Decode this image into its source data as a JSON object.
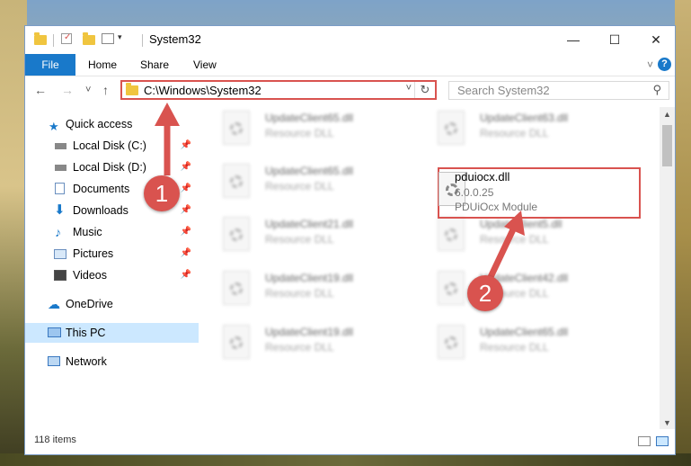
{
  "window": {
    "title": "System32",
    "minimize": "—",
    "maximize": "☐",
    "close": "✕"
  },
  "ribbon": {
    "tabs": [
      "File",
      "Home",
      "Share",
      "View"
    ],
    "expand": "˅",
    "help": "?"
  },
  "nav": {
    "back": "←",
    "forward": "→",
    "recent": "˅",
    "up": "↑",
    "address": "C:\\Windows\\System32",
    "address_dropdown": "˅",
    "refresh": "↻",
    "search_placeholder": "Search System32",
    "search_icon": "search-icon"
  },
  "navpane": {
    "items": [
      {
        "label": "Quick access",
        "icon": "star-icon",
        "pinned": false
      },
      {
        "label": "Local Disk (C:)",
        "icon": "drive-icon",
        "pinned": true
      },
      {
        "label": "Local Disk (D:)",
        "icon": "drive-icon",
        "pinned": true
      },
      {
        "label": "Documents",
        "icon": "documents-icon",
        "pinned": true
      },
      {
        "label": "Downloads",
        "icon": "download-icon",
        "pinned": true
      },
      {
        "label": "Music",
        "icon": "music-icon",
        "pinned": true
      },
      {
        "label": "Pictures",
        "icon": "pictures-icon",
        "pinned": true
      },
      {
        "label": "Videos",
        "icon": "videos-icon",
        "pinned": true
      },
      {
        "label": "OneDrive",
        "icon": "cloud-icon",
        "pinned": false
      },
      {
        "label": "This PC",
        "icon": "computer-icon",
        "pinned": false
      },
      {
        "label": "Network",
        "icon": "network-icon",
        "pinned": false
      }
    ],
    "pin_glyph": "📌"
  },
  "files": [
    {
      "name": "UpdateClient65.dll",
      "desc": "Resource DLL"
    },
    {
      "name": "UpdateClient63.dll",
      "desc": "Resource DLL"
    },
    {
      "name": "UpdateClient65.dll",
      "desc": "Resource DLL"
    },
    {
      "name": "UpdateClient21.dll",
      "desc": "Resource DLL"
    },
    {
      "name": "UpdateClient5.dll",
      "desc": "Resource DLL"
    },
    {
      "name": "UpdateClient19.dll",
      "desc": "Resource DLL"
    },
    {
      "name": "UpdateClient42.dll",
      "desc": "Resource DLL"
    },
    {
      "name": "UpdateClient19.dll",
      "desc": "Resource DLL"
    },
    {
      "name": "UpdateClient65.dll",
      "desc": "Resource DLL"
    }
  ],
  "highlighted_file": {
    "name": "pduiocx.dll",
    "version": "6.0.0.25",
    "desc": "PDUiOcx Module"
  },
  "status": {
    "items": "118 items"
  },
  "callouts": [
    "1",
    "2"
  ],
  "colors": {
    "accent": "#1979ca",
    "highlight": "#d9534f",
    "selected": "#cce8ff"
  }
}
